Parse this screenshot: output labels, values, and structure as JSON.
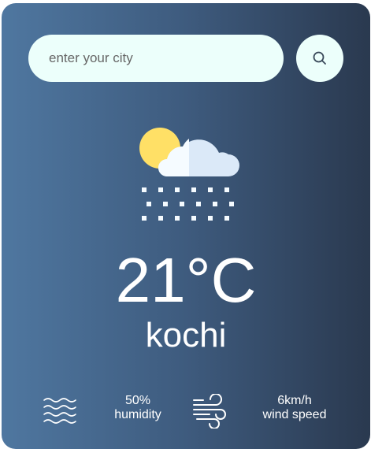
{
  "search": {
    "placeholder": "enter your city",
    "button_icon": "search-icon"
  },
  "weather": {
    "icon": "rain-cloud-sun-icon",
    "temperature": "21°C",
    "city": "kochi"
  },
  "details": {
    "humidity": {
      "icon": "humidity-waves-icon",
      "value": "50%",
      "label": "humidity"
    },
    "wind": {
      "icon": "wind-icon",
      "value": "6km/h",
      "label": "wind speed"
    }
  },
  "colors": {
    "card_gradient_start": "#4f77a0",
    "card_gradient_end": "#2a394f",
    "input_background": "#ecfffb",
    "sun": "#ffe066",
    "cloud_light": "#f5fbff",
    "cloud_shade": "#dbe9f8",
    "text": "#ffffff"
  }
}
